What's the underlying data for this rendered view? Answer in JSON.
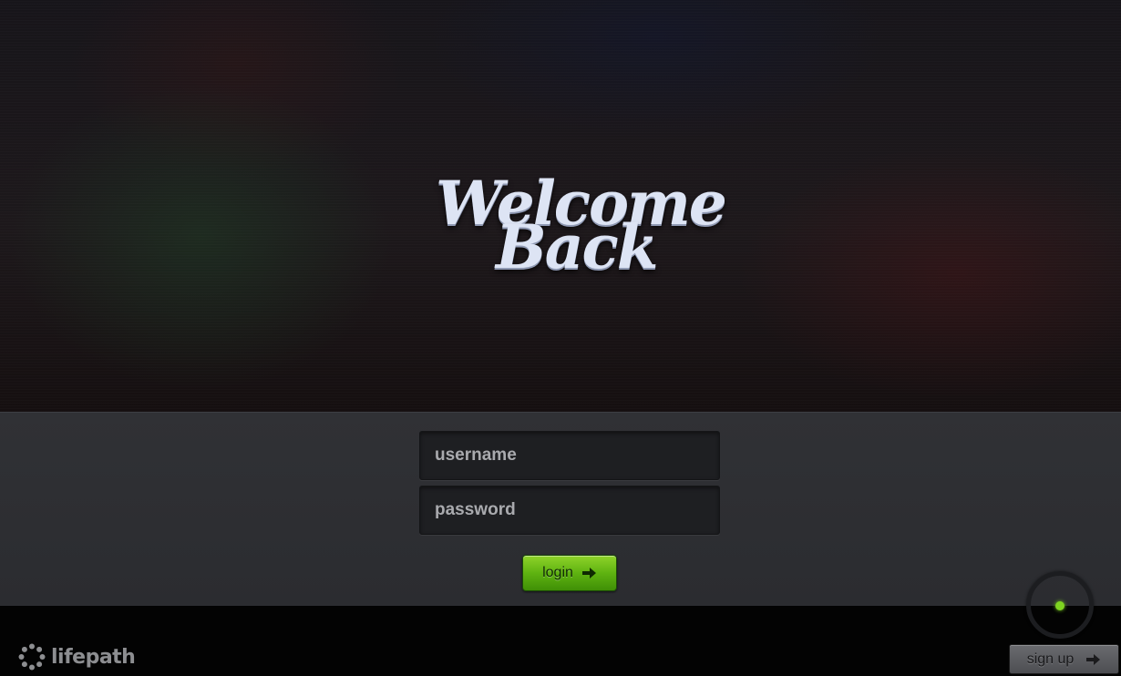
{
  "hero": {
    "headline_line_1": "Welcome",
    "headline_line_2": "Back"
  },
  "login_form": {
    "username_placeholder": "username",
    "username_value": "",
    "password_placeholder": "password",
    "password_value": "",
    "login_label": "login",
    "login_icon": "arrow-right-icon"
  },
  "loading_indicator": {
    "icon": "spinner-icon",
    "accent_color": "#7ed321"
  },
  "footer": {
    "brand": "lifepath",
    "brand_icon": "lifepath-logo-icon",
    "signup_label": "sign up",
    "signup_icon": "arrow-right-icon"
  },
  "colors": {
    "accent_green": "#5fb311",
    "panel_bg": "#2e2f33",
    "footer_bg": "#030303",
    "headline_text": "#dde4f4"
  }
}
